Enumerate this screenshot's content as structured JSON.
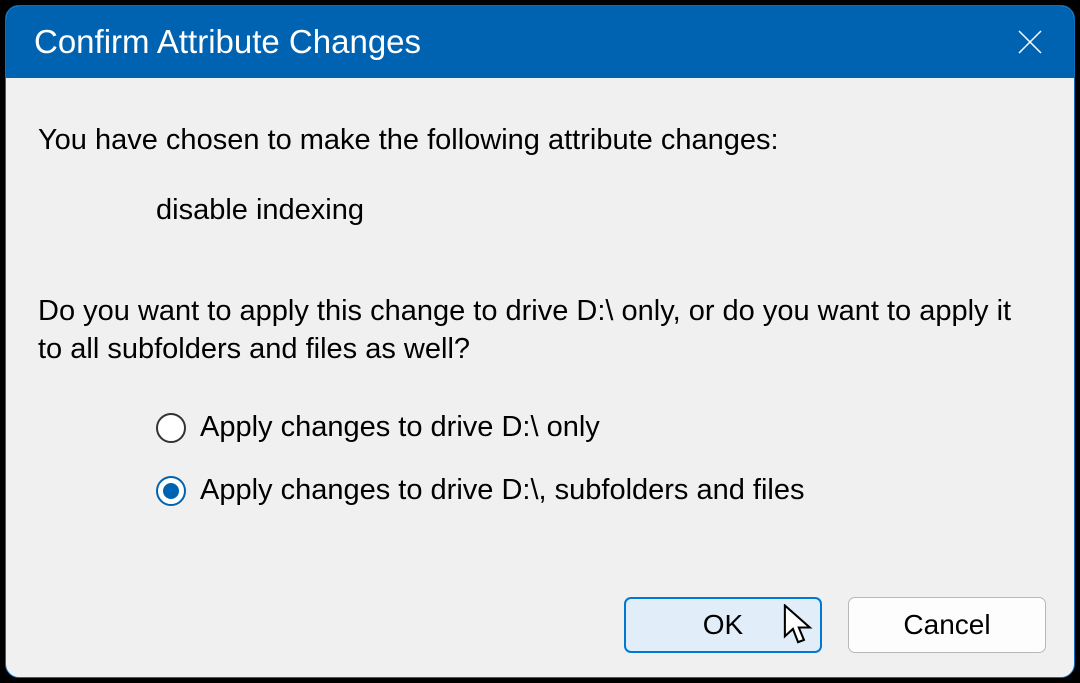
{
  "titlebar": {
    "title": "Confirm Attribute Changes"
  },
  "content": {
    "intro": "You have chosen to make the following attribute changes:",
    "attribute_change": "disable indexing",
    "question": "Do you want to apply this change to drive D:\\ only, or do you want to apply it to all subfolders and files as well?"
  },
  "radios": {
    "option1": "Apply changes to drive D:\\ only",
    "option2": "Apply changes to drive D:\\, subfolders and files",
    "selected": 2
  },
  "buttons": {
    "ok": "OK",
    "cancel": "Cancel"
  }
}
